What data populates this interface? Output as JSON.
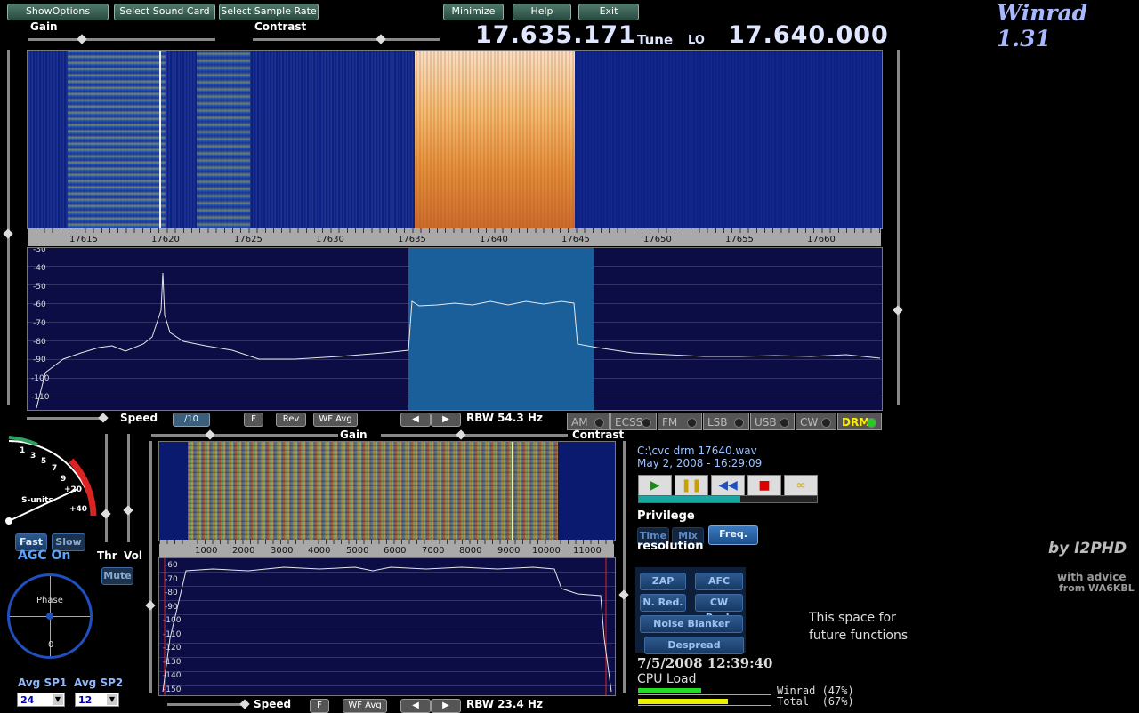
{
  "toolbar": {
    "show_options": "ShowOptions",
    "select_sound_card": "Select Sound Card",
    "select_sample_rate": "Select Sample Rate",
    "minimize": "Minimize",
    "help": "Help",
    "exit": "Exit"
  },
  "app": {
    "title": "Winrad 1.31",
    "by": "by I2PHD",
    "advice1": "with advice",
    "advice2": "from WA6KBL"
  },
  "top": {
    "gain_label": "Gain",
    "contrast_label": "Contrast",
    "tune_freq": "17.635.171",
    "tune_label": "Tune",
    "lo_label": "LO",
    "lo_freq": "17.640.000"
  },
  "main_axis": {
    "ticks": [
      "17615",
      "17620",
      "17625",
      "17630",
      "17635",
      "17640",
      "17645",
      "17650",
      "17655",
      "17660"
    ],
    "ylabels": [
      "-30",
      "-40",
      "-50",
      "-60",
      "-70",
      "-80",
      "-90",
      "-100",
      "-110"
    ]
  },
  "controls_row": {
    "speed_label": "Speed",
    "div10": "/10",
    "f": "F",
    "rev": "Rev",
    "wf_avg": "WF Avg",
    "rbw": "RBW 54.3 Hz"
  },
  "modes": [
    {
      "label": "AM"
    },
    {
      "label": "ECSS"
    },
    {
      "label": "FM"
    },
    {
      "label": "LSB"
    },
    {
      "label": "USB"
    },
    {
      "label": "CW"
    },
    {
      "label": "DRM"
    }
  ],
  "colors": {
    "drm_active": "#ffee00",
    "led_on": "#22cc22",
    "spectrum_bg": "#0b0d44",
    "passband": "#1a5f9a"
  },
  "smeter": {
    "ticks": [
      "1",
      "3",
      "5",
      "7",
      "9",
      "+20",
      "+40"
    ],
    "label": "S-units"
  },
  "agc": {
    "fast": "Fast",
    "slow": "Slow",
    "status": "AGC On",
    "thr": "Thr",
    "vol": "Vol",
    "mute": "Mute"
  },
  "phase": {
    "label": "Phase",
    "zero": "0"
  },
  "avg": {
    "sp1_label": "Avg SP1",
    "sp2_label": "Avg SP2",
    "sp1_value": "24",
    "sp2_value": "12"
  },
  "sub": {
    "gain_label": "Gain",
    "contrast_label": "Contrast",
    "ticks": [
      "1000",
      "2000",
      "3000",
      "4000",
      "5000",
      "6000",
      "7000",
      "8000",
      "9000",
      "10000",
      "11000"
    ],
    "ylabels": [
      "-60",
      "-70",
      "-80",
      "-90",
      "-100",
      "-110",
      "-120",
      "-130",
      "-140",
      "-150"
    ],
    "speed_label": "Speed",
    "f": "F",
    "wf_avg": "WF Avg",
    "rbw": "RBW 23.4 Hz"
  },
  "file": {
    "path": "C:\\cvc  drm  17640.wav",
    "date": "May 2, 2008  -  16:29:09"
  },
  "player": {
    "progress": 0.57
  },
  "privilege": {
    "label": "Privilege",
    "resolution": "resolution",
    "time": "Time",
    "mix": "Mix",
    "freq": "Freq."
  },
  "func": {
    "zap": "ZAP",
    "afc": "AFC",
    "nred": "N. Red.",
    "cwpeak": "CW Peak",
    "noise_blanker": "Noise Blanker",
    "despread": "Despread"
  },
  "future": {
    "line1": "This space for",
    "line2": "future functions"
  },
  "clock": "7/5/2008 12:39:40",
  "cpu": {
    "label": "CPU Load",
    "winrad_label": "Winrad (47%)",
    "total_label": "Total  (67%)",
    "winrad": 0.47,
    "total": 0.67
  }
}
